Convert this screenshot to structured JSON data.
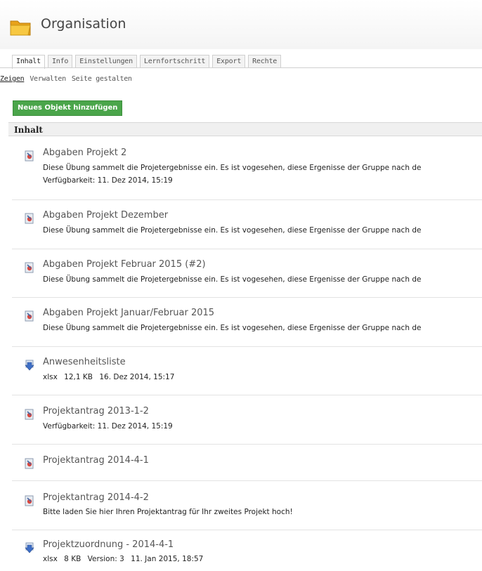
{
  "header": {
    "title": "Organisation",
    "icon": "folder-icon"
  },
  "tabs": [
    "Inhalt",
    "Info",
    "Einstellungen",
    "Lernfortschritt",
    "Export",
    "Rechte"
  ],
  "subtabs": [
    "Zeigen",
    "Verwalten",
    "Seite gestalten"
  ],
  "toolbar": {
    "add_label": "Neues Objekt hinzufügen"
  },
  "section": {
    "title": "Inhalt"
  },
  "items": [
    {
      "title": "Abgaben Projekt 2",
      "description": "Diese Übung sammelt die Projetergebnisse ein. Es ist vogesehen, diese Ergenisse der Gruppe nach de",
      "availability": "Verfügbarkeit: 11. Dez 2014, 15:19",
      "icon": "exercise-icon"
    },
    {
      "title": "Abgaben Projekt Dezember",
      "description": "Diese Übung sammelt die Projetergebnisse ein. Es ist vogesehen, diese Ergenisse der Gruppe nach de",
      "icon": "exercise-icon"
    },
    {
      "title": "Abgaben Projekt Februar 2015 (#2)",
      "description": "Diese Übung sammelt die Projetergebnisse ein. Es ist vogesehen, diese Ergenisse der Gruppe nach de",
      "icon": "exercise-icon"
    },
    {
      "title": "Abgaben Projekt Januar/Februar 2015",
      "description": "Diese Übung sammelt die Projetergebnisse ein. Es ist vogesehen, diese Ergenisse der Gruppe nach de",
      "icon": "exercise-icon"
    },
    {
      "title": "Anwesenheitsliste",
      "icon": "file-download-icon",
      "meta": {
        "type": "xlsx",
        "size": "12,1 KB",
        "date": "16. Dez 2014, 15:17"
      }
    },
    {
      "title": "Projektantrag 2013-1-2",
      "availability": "Verfügbarkeit: 11. Dez 2014, 15:19",
      "icon": "exercise-icon"
    },
    {
      "title": "Projektantrag 2014-4-1",
      "icon": "exercise-icon"
    },
    {
      "title": "Projektantrag 2014-4-2",
      "description": "Bitte laden Sie hier Ihren Projektantrag für Ihr zweites Projekt hoch!",
      "icon": "exercise-icon"
    },
    {
      "title": "Projektzuordnung - 2014-4-1",
      "icon": "file-download-icon",
      "meta": {
        "type": "xlsx",
        "size": "8 KB",
        "version": "Version: 3",
        "date": "11. Jan 2015, 18:57"
      }
    }
  ],
  "colors": {
    "add_button": "#4aa54a",
    "section_bg": "#f0f0f0"
  }
}
